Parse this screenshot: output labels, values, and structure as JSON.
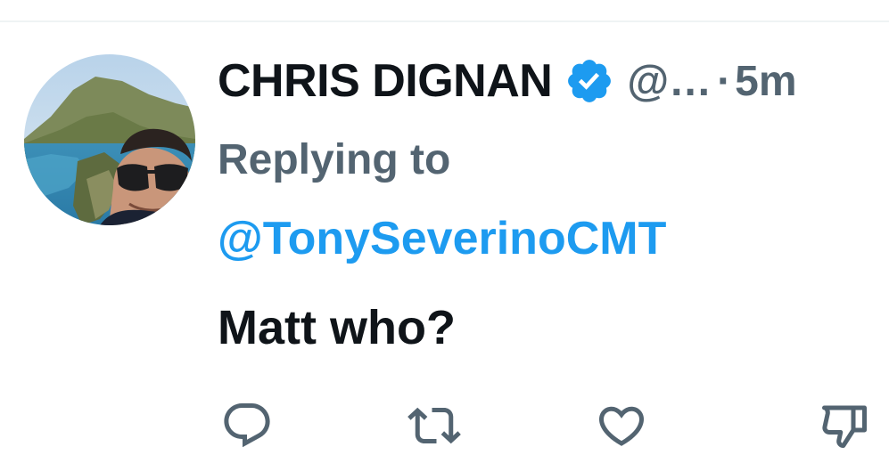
{
  "tweet": {
    "display_name": "CHRIS DIGNAN",
    "handle": "@…",
    "separator": "·",
    "time": "5m",
    "replying_label": "Replying to",
    "replying_to": "@TonySeverinoCMT",
    "text": "Matt who?"
  },
  "icons": {
    "verified": "verified-badge-icon",
    "reply": "reply-icon",
    "retweet": "retweet-icon",
    "like": "like-icon",
    "dislike": "dislike-icon"
  },
  "colors": {
    "text_primary": "#0f1419",
    "text_secondary": "#536471",
    "accent_blue": "#1d9bf0"
  }
}
